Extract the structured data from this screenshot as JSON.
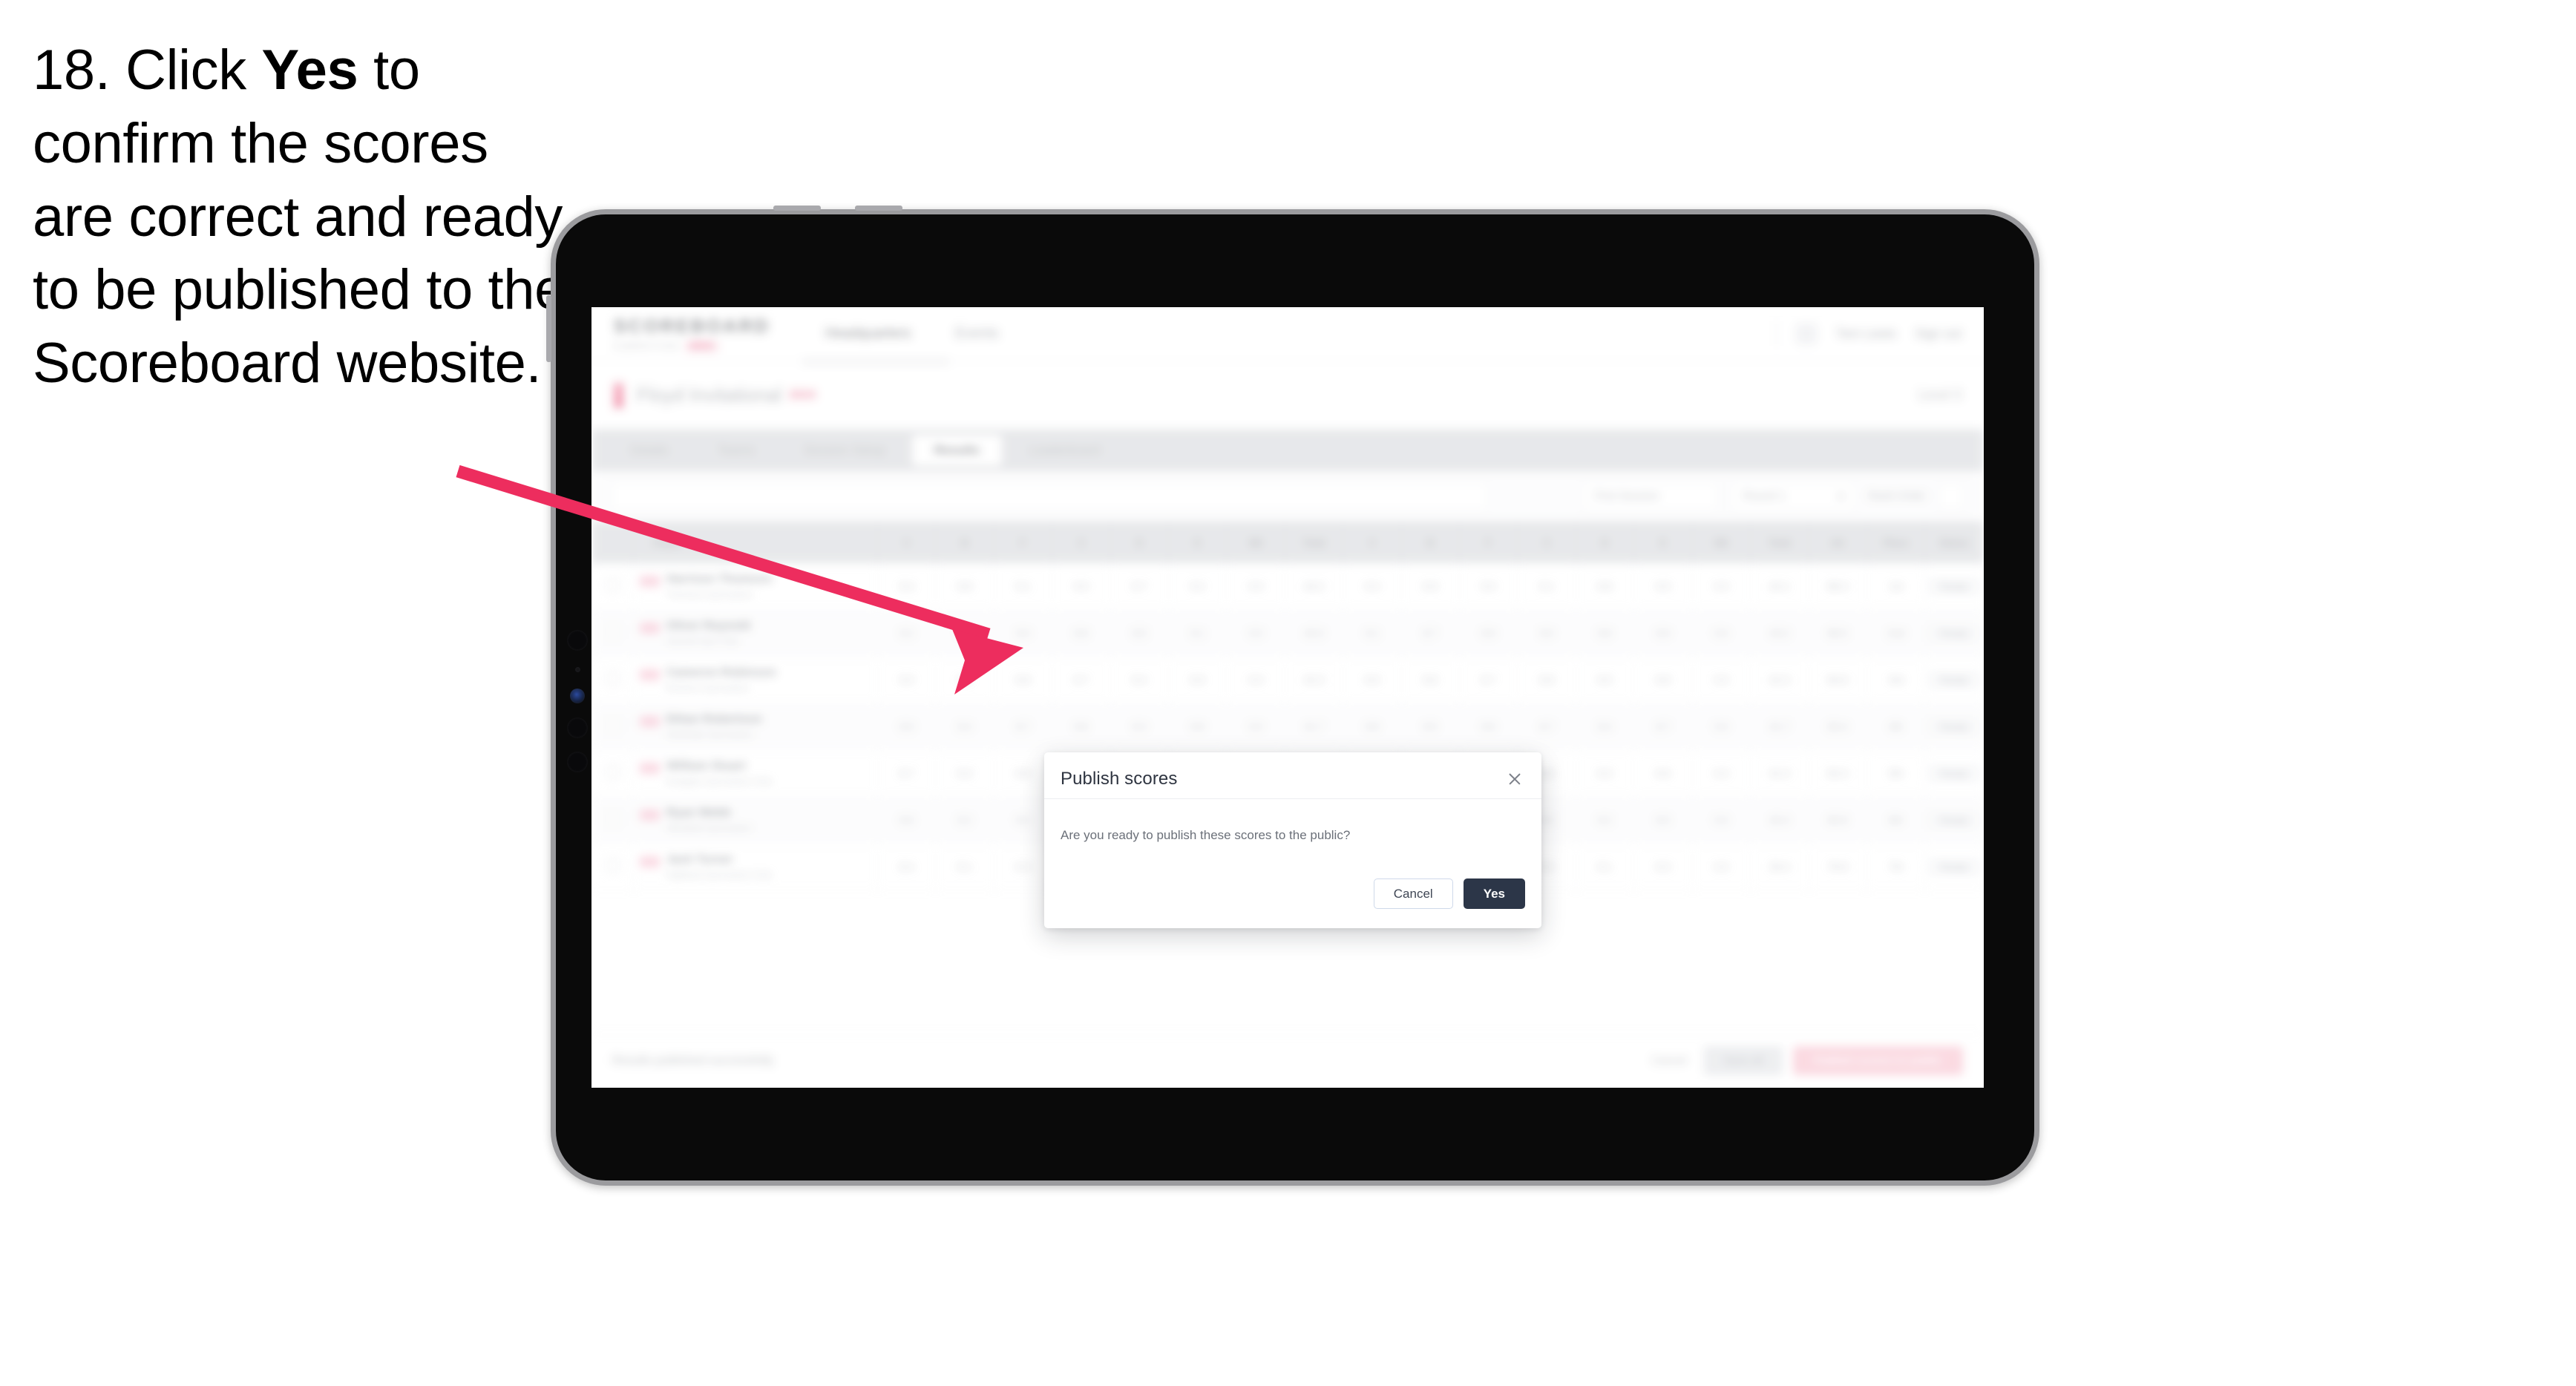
{
  "caption": {
    "step_number": "18.",
    "before": "Click ",
    "bold": "Yes",
    "after": " to confirm the scores are correct and ready to be published to the Scoreboard website."
  },
  "annotation": {
    "arrow_color": "#ED2D5E",
    "points_to": "Yes"
  },
  "device": {
    "type": "tablet",
    "frame_color": "#9B9B9E",
    "body_color": "#0A0A0A"
  },
  "app": {
    "header": {
      "logo": "SCOREBOARD",
      "logo_subtitle": "COMPETITION",
      "logo_badge": "BETA",
      "nav": [
        {
          "label": "Headquarters",
          "active": true
        },
        {
          "label": "Events",
          "active": false
        }
      ],
      "account_name": "Tom Lewis",
      "sign_out": "Sign out"
    },
    "title_bar": {
      "competition": "Floyd Invitational",
      "year": "2024",
      "right_label": "Level 3"
    },
    "tabs": [
      {
        "label": "Details",
        "active": false
      },
      {
        "label": "Teams",
        "active": false
      },
      {
        "label": "Session Setup",
        "active": false
      },
      {
        "label": "Results",
        "active": true
      },
      {
        "label": "Leaderboard",
        "active": false
      }
    ],
    "toolbar": {
      "search_placeholder": "Search players",
      "filter_session": "First Session",
      "filter_round": "Round 1",
      "filter_sort": "Rank Order"
    },
    "table": {
      "columns": [
        "",
        "Player",
        "V",
        "B",
        "F",
        "X",
        "D",
        "E",
        "ND",
        "Total",
        "V",
        "B",
        "F",
        "X",
        "D",
        "E",
        "ND",
        "Total",
        "AA",
        "Place",
        "Status"
      ],
      "rows": [
        {
          "name": "Harrison Thomson",
          "club": "Thomson Gymnastics",
          "scores": [
            "9.4",
            "8.8",
            "9.1",
            "9.0",
            "8.7",
            "9.2",
            "0.0",
            "44.2",
            "9.3",
            "8.9",
            "9.0",
            "9.1",
            "8.8",
            "9.0",
            "0.0",
            "44.1"
          ],
          "aa": "88.3",
          "place": "1st",
          "status": "Ready",
          "badge": "U14"
        },
        {
          "name": "Oliver Reynold",
          "club": "Summit Gym Club",
          "scores": [
            "9.2",
            "8.6",
            "9.0",
            "8.9",
            "8.5",
            "9.1",
            "0.0",
            "43.3",
            "9.1",
            "8.7",
            "8.9",
            "9.0",
            "8.6",
            "8.9",
            "0.0",
            "43.2"
          ],
          "aa": "86.5",
          "place": "2nd",
          "status": "Ready",
          "badge": "U14"
        },
        {
          "name": "Cameron Robinson",
          "club": "Riverton Gymnastics",
          "scores": [
            "9.0",
            "8.5",
            "8.8",
            "8.7",
            "8.4",
            "8.9",
            "0.0",
            "42.3",
            "8.9",
            "8.6",
            "8.7",
            "8.8",
            "8.5",
            "8.8",
            "0.0",
            "42.3"
          ],
          "aa": "84.6",
          "place": "3rd",
          "status": "Ready",
          "badge": "U14"
        },
        {
          "name": "Ethan Robertson",
          "club": "Northside Gymnastics",
          "scores": [
            "8.9",
            "8.4",
            "8.7",
            "8.6",
            "8.3",
            "8.8",
            "0.0",
            "41.7",
            "8.8",
            "8.5",
            "8.6",
            "8.7",
            "8.4",
            "8.7",
            "0.0",
            "41.7"
          ],
          "aa": "83.4",
          "place": "4th",
          "status": "Ready",
          "badge": "U14"
        },
        {
          "name": "William Stuart",
          "club": "Eastgate Gymnastics Club",
          "scores": [
            "8.7",
            "8.3",
            "8.6",
            "8.5",
            "8.2",
            "8.7",
            "0.0",
            "41.0",
            "8.6",
            "8.4",
            "8.5",
            "8.6",
            "8.3",
            "8.6",
            "0.0",
            "41.0"
          ],
          "aa": "82.0",
          "place": "5th",
          "status": "Ready",
          "badge": "U14"
        },
        {
          "name": "Ryan Webb",
          "club": "Westfield Gymnastics",
          "scores": [
            "8.6",
            "8.2",
            "8.5",
            "8.4",
            "8.1",
            "8.6",
            "0.0",
            "40.4",
            "8.5",
            "8.3",
            "8.4",
            "8.5",
            "8.2",
            "8.5",
            "0.0",
            "40.4"
          ],
          "aa": "80.8",
          "place": "6th",
          "status": "Ready",
          "badge": "U14"
        },
        {
          "name": "Jack Turner",
          "club": "Highland Gymnastics Club",
          "scores": [
            "8.4",
            "8.1",
            "8.3",
            "8.2",
            "8.0",
            "8.4",
            "0.0",
            "39.4",
            "8.3",
            "8.2",
            "8.2",
            "8.3",
            "8.1",
            "8.3",
            "0.0",
            "39.4"
          ],
          "aa": "78.8",
          "place": "7th",
          "status": "Ready",
          "badge": "U14"
        }
      ]
    },
    "bottom_bar": {
      "note": "Results published successfully",
      "ghost_action": "Cancel",
      "secondary_action": "Save all",
      "primary_action": "Publish scores to public"
    }
  },
  "modal": {
    "title": "Publish scores",
    "message": "Are you ready to publish these scores to the public?",
    "cancel_label": "Cancel",
    "confirm_label": "Yes",
    "close_icon": "close-icon",
    "confirm_color": "#2C3648"
  }
}
